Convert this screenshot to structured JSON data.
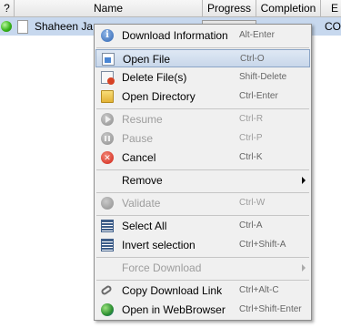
{
  "table": {
    "columns": [
      "?",
      "Name",
      "Progress",
      "Completion",
      "E"
    ],
    "row": {
      "name": "Shaheen Ja",
      "completion": "CO"
    }
  },
  "context_menu": {
    "items": [
      {
        "label": "Download Information",
        "shortcut": "Alt-Enter",
        "icon": "info-icon",
        "enabled": true
      },
      {
        "label": "Open File",
        "shortcut": "Ctrl-O",
        "icon": "open-file-icon",
        "enabled": true,
        "selected": true
      },
      {
        "label": "Delete File(s)",
        "shortcut": "Shift-Delete",
        "icon": "delete-file-icon",
        "enabled": true
      },
      {
        "label": "Open Directory",
        "shortcut": "Ctrl-Enter",
        "icon": "folder-icon",
        "enabled": true
      },
      {
        "label": "Resume",
        "shortcut": "Ctrl-R",
        "icon": "resume-icon",
        "enabled": false
      },
      {
        "label": "Pause",
        "shortcut": "Ctrl-P",
        "icon": "pause-icon",
        "enabled": false
      },
      {
        "label": "Cancel",
        "shortcut": "Ctrl-K",
        "icon": "cancel-icon",
        "enabled": true
      },
      {
        "label": "Remove",
        "shortcut": "",
        "icon": "",
        "enabled": true,
        "submenu": true
      },
      {
        "label": "Validate",
        "shortcut": "Ctrl-W",
        "icon": "validate-icon",
        "enabled": false
      },
      {
        "label": "Select All",
        "shortcut": "Ctrl-A",
        "icon": "select-all-icon",
        "enabled": true
      },
      {
        "label": "Invert selection",
        "shortcut": "Ctrl+Shift-A",
        "icon": "invert-selection-icon",
        "enabled": true
      },
      {
        "label": "Force Download",
        "shortcut": "",
        "icon": "",
        "enabled": false,
        "submenu": true
      },
      {
        "label": "Copy Download Link",
        "shortcut": "Ctrl+Alt-C",
        "icon": "link-icon",
        "enabled": true
      },
      {
        "label": "Open in WebBrowser",
        "shortcut": "Ctrl+Shift-Enter",
        "icon": "web-browser-icon",
        "enabled": true
      }
    ]
  },
  "colors": {
    "selection_row": "#c7d8ee",
    "menu_background": "#f0f0f0",
    "menu_highlight": "#c8d7ea",
    "disabled_text": "#9d9d9d"
  }
}
